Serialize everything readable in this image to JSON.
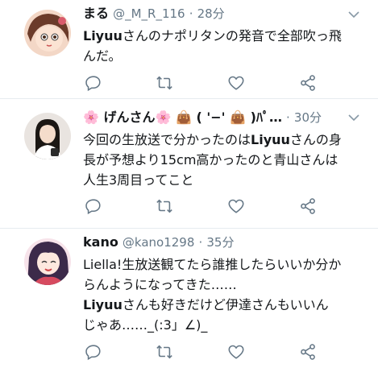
{
  "tweets": [
    {
      "name": "まる",
      "handle": "@_M_R_116",
      "dot": "·",
      "time": "28分",
      "lines": [
        {
          "bold": "Liyuu",
          "rest": "さんのナポリタンの発音で全部吹っ飛"
        },
        {
          "bold": "",
          "rest": "んだ。"
        }
      ],
      "icons": {
        "reply": "reply-icon",
        "retweet": "retweet-icon",
        "like": "like-icon",
        "share": "share-icon",
        "more": "chevron-down-icon"
      }
    },
    {
      "name": "🌸 げんさん🌸 👜 ( '−' 👜 )ﾊﾟ…",
      "handle": "",
      "dot": "·",
      "time": "30分",
      "lines": [
        {
          "pre": "今回の生放送で分かったのは",
          "bold": "Liyuu",
          "rest": "さんの身"
        },
        {
          "bold": "",
          "rest": "長が予想より15cm高かったのと青山さんは"
        },
        {
          "bold": "",
          "rest": "人生3周目ってこと"
        }
      ],
      "icons": {
        "reply": "reply-icon",
        "retweet": "retweet-icon",
        "like": "like-icon",
        "share": "share-icon",
        "more": "chevron-down-icon"
      }
    },
    {
      "name": "kano",
      "handle": "@kano1298",
      "dot": "·",
      "time": "35分",
      "lines": [
        {
          "bold": "",
          "rest": "Liella!生放送観てたら誰推したらいいか分か"
        },
        {
          "bold": "",
          "rest": "らんようになってきた……"
        },
        {
          "bold": "Liyuu",
          "rest": "さんも好きだけど伊達さんもいいん"
        },
        {
          "bold": "",
          "rest": "じゃあ……_(:3」∠)_"
        }
      ],
      "icons": {
        "reply": "reply-icon",
        "retweet": "retweet-icon",
        "like": "like-icon",
        "share": "share-icon",
        "more": "chevron-down-icon"
      }
    }
  ],
  "colors": {
    "text": "#14171a",
    "secondary": "#657786",
    "icon": "#657786",
    "border": "#e6ecf0"
  }
}
